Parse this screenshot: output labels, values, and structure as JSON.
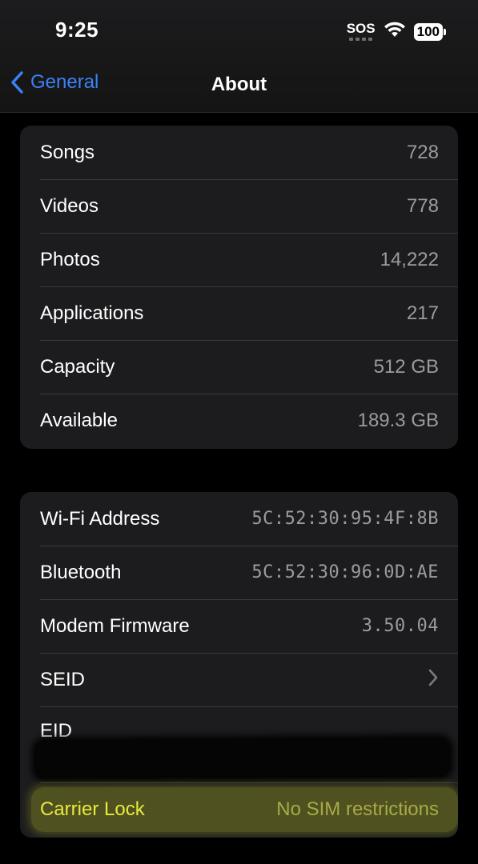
{
  "status_bar": {
    "time": "9:25",
    "sos": "SOS",
    "battery": "100",
    "wifi_icon": "wifi-icon"
  },
  "nav": {
    "back_label": "General",
    "title": "About"
  },
  "media_group": {
    "rows": [
      {
        "label": "Songs",
        "value": "728"
      },
      {
        "label": "Videos",
        "value": "778"
      },
      {
        "label": "Photos",
        "value": "14,222"
      },
      {
        "label": "Applications",
        "value": "217"
      },
      {
        "label": "Capacity",
        "value": "512 GB"
      },
      {
        "label": "Available",
        "value": "189.3 GB"
      }
    ]
  },
  "network_group": {
    "wifi": {
      "label": "Wi-Fi Address",
      "value": "5C:52:30:95:4F:8B"
    },
    "bluetooth": {
      "label": "Bluetooth",
      "value": "5C:52:30:96:0D:AE"
    },
    "modem": {
      "label": "Modem Firmware",
      "value": "3.50.04"
    },
    "seid": {
      "label": "SEID"
    },
    "eid": {
      "label": "EID"
    },
    "carrier": {
      "label": "Carrier Lock",
      "value": "No SIM restrictions"
    }
  },
  "colors": {
    "accent": "#3b82f6",
    "background": "#000000",
    "group_background": "#1c1c1e",
    "highlight": "#c8cd28"
  }
}
